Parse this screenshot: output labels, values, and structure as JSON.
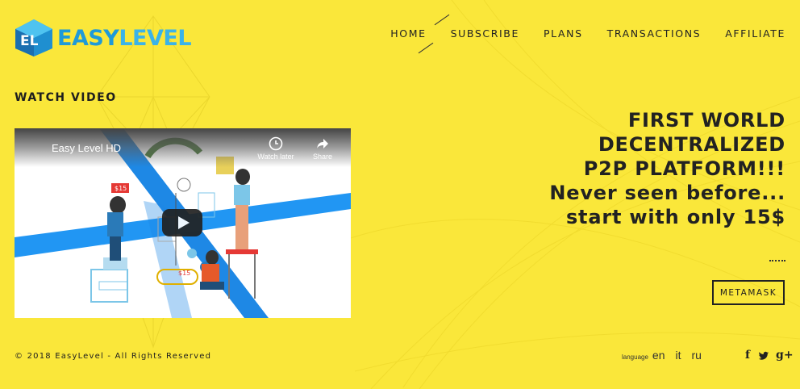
{
  "brand": {
    "part1": "EASY",
    "part2": "LEVEL"
  },
  "nav": [
    {
      "label": "HOME"
    },
    {
      "label": "SUBSCRIBE"
    },
    {
      "label": "PLANS"
    },
    {
      "label": "TRANSACTIONS"
    },
    {
      "label": "AFFILIATE"
    }
  ],
  "video": {
    "section_title": "WATCH VIDEO",
    "title": "Easy Level HD",
    "watch_later": "Watch later",
    "share": "Share",
    "price_tag": "$15",
    "icons": [
      "clock-icon",
      "share-icon",
      "play-icon"
    ]
  },
  "hero": {
    "lines": [
      "FIRST WORLD",
      "DECENTRALIZED",
      "P2P PLATFORM!!!",
      "Never seen before...",
      "start with only 15$"
    ],
    "button": "METAMASK"
  },
  "footer": {
    "copyright": "© 2018 EasyLevel - All Rights Reserved",
    "language_label": "language",
    "languages": [
      "en",
      "it",
      "ru"
    ],
    "social": [
      {
        "icon": "facebook-icon",
        "glyph": "f"
      },
      {
        "icon": "twitter-icon",
        "glyph": "t"
      },
      {
        "icon": "google-plus-icon",
        "glyph": "g+"
      }
    ]
  },
  "colors": {
    "background": "#fae73a",
    "brand": "#1f9ad8",
    "accent_blue": "#1e88e5"
  }
}
